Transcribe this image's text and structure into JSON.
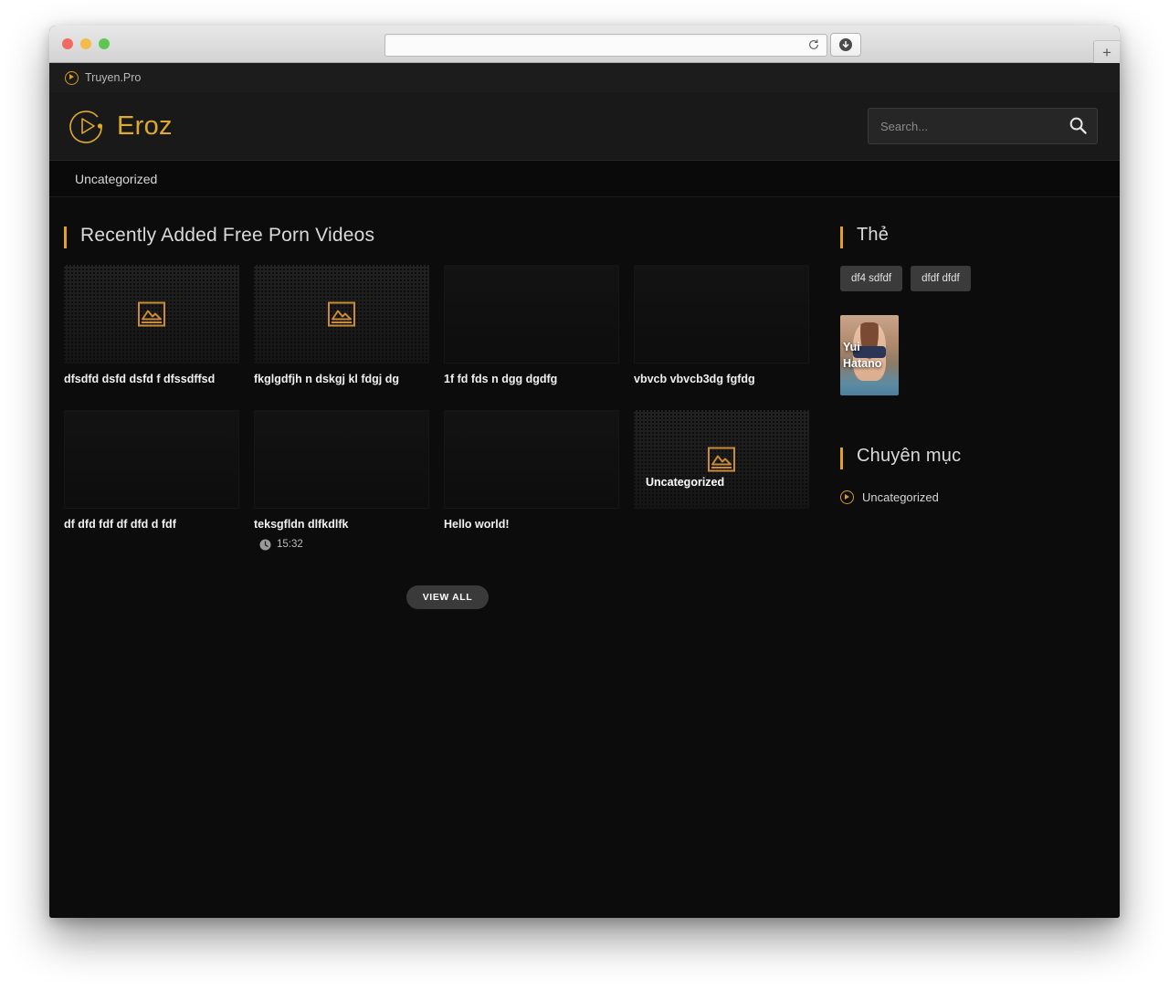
{
  "browser": {
    "url_value": "",
    "url_placeholder": "",
    "reload_icon": "reload-icon",
    "download_icon": "download-icon",
    "newtab_label": "+"
  },
  "topbar": {
    "icon": "play-circle-icon",
    "label": "Truyen.Pro"
  },
  "header": {
    "logo_icon": "play-circle-logo-icon",
    "logo_text": "Eroz",
    "search_placeholder": "Search...",
    "search_value": "",
    "search_icon": "search-icon"
  },
  "nav": {
    "items": [
      {
        "label": "Uncategorized"
      }
    ]
  },
  "main": {
    "section_title": "Recently Added Free Porn Videos",
    "view_all_label": "VIEW ALL",
    "cards": [
      {
        "title": "dfsdfd dsfd dsfd f dfssdffsd",
        "thumb": "patterned",
        "icon": "image-placeholder-icon",
        "duration": "",
        "overlay": ""
      },
      {
        "title": "fkglgdfjh n dskgj kl fdgj dg",
        "thumb": "patterned",
        "icon": "image-placeholder-icon",
        "duration": "",
        "overlay": ""
      },
      {
        "title": "1f fd fds n dgg dgdfg",
        "thumb": "plain",
        "icon": "",
        "duration": "",
        "overlay": ""
      },
      {
        "title": "vbvcb vbvcb3dg fgfdg",
        "thumb": "plain",
        "icon": "",
        "duration": "",
        "overlay": ""
      },
      {
        "title": "df dfd fdf df dfd d fdf",
        "thumb": "plain",
        "icon": "",
        "duration": "",
        "overlay": ""
      },
      {
        "title": "teksgfldn dlfkdlfk",
        "thumb": "plain",
        "icon": "",
        "duration": "15:32",
        "overlay": ""
      },
      {
        "title": "Hello world!",
        "thumb": "plain",
        "icon": "",
        "duration": "",
        "overlay": ""
      },
      {
        "title": "",
        "thumb": "patterned",
        "icon": "image-placeholder-icon",
        "duration": "",
        "overlay": "Uncategorized"
      }
    ]
  },
  "sidebar": {
    "tags_title": "Thẻ",
    "tags": [
      {
        "label": "df4 sdfdf"
      },
      {
        "label": "dfdf dfdf"
      }
    ],
    "person": {
      "name_line1": "Yui",
      "name_line2": "Hatano"
    },
    "categories_title": "Chuyên mục",
    "categories": [
      {
        "label": "Uncategorized",
        "icon": "play-circle-icon"
      }
    ]
  },
  "colors": {
    "accent": "#e0a02a",
    "logo_gold": "#dda92f",
    "site_bg": "#0c0c0c",
    "header_bg": "#191919"
  }
}
